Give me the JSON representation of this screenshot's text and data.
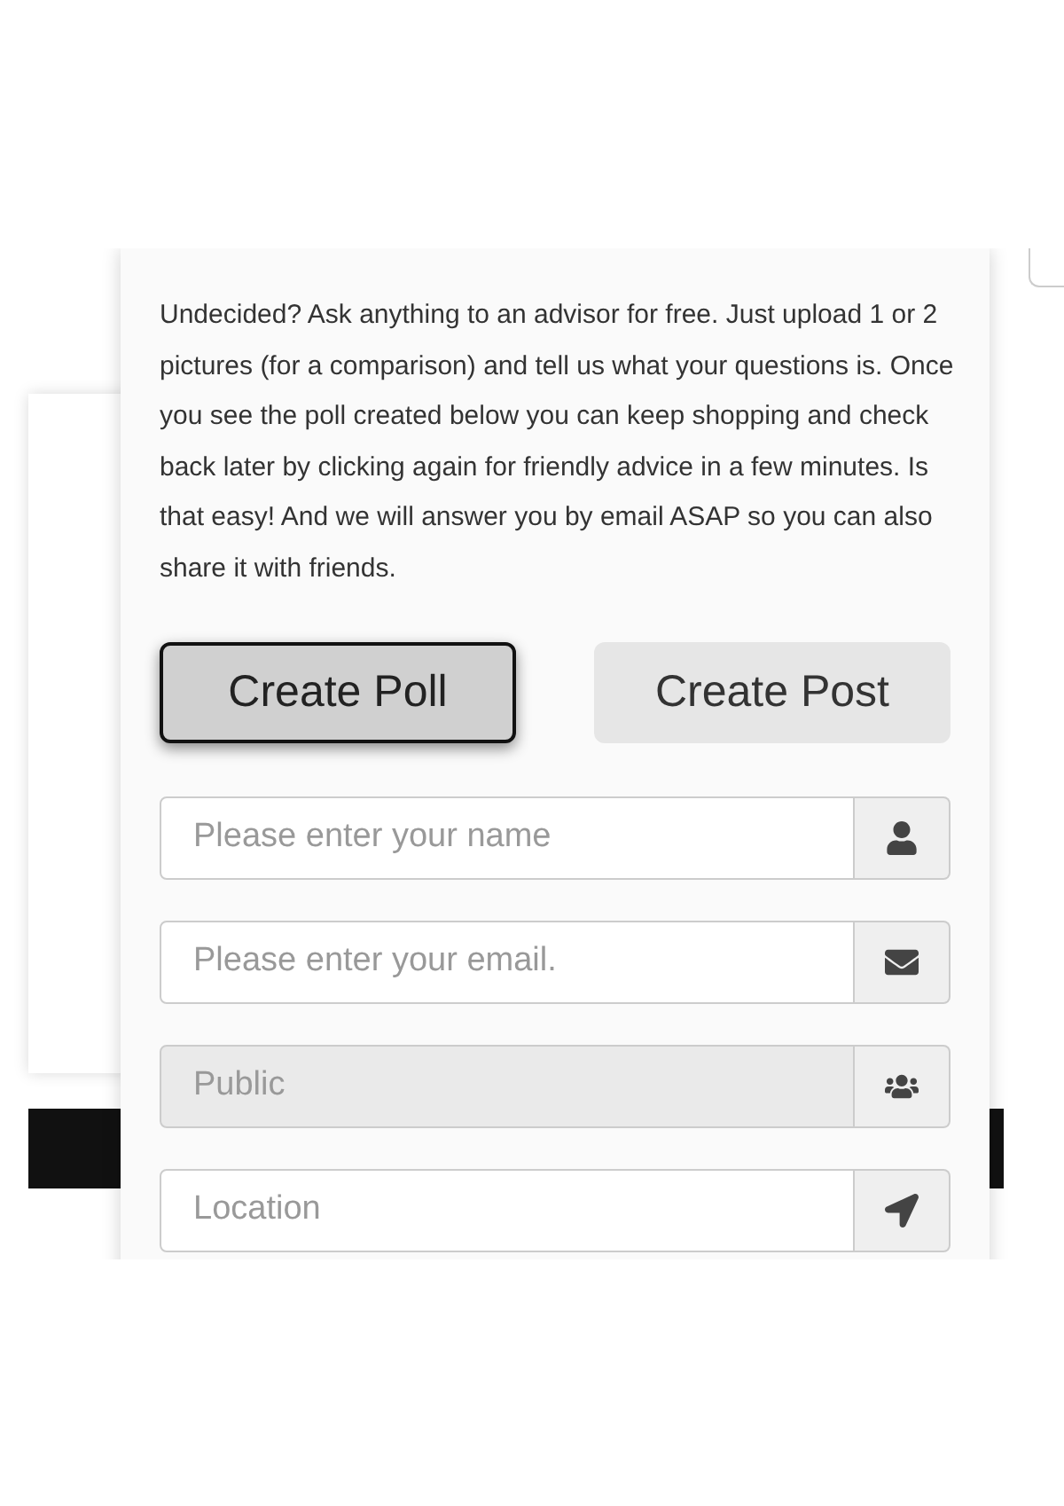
{
  "intro": "Undecided? Ask anything to an advisor for free. Just upload 1 or 2 pictures (for a comparison) and tell us what your questions is. Once you see the poll created below you can keep shopping and check back later by clicking again for friendly advice in a few minutes. Is that easy! And we will answer you by email ASAP so you can also share it with friends.",
  "tabs": [
    {
      "label": "Create Poll",
      "selected": true
    },
    {
      "label": "Create Post",
      "selected": false
    }
  ],
  "fields": [
    {
      "placeholder": "Please enter your name",
      "kind": "name",
      "disabled": false
    },
    {
      "placeholder": "Please enter your email.",
      "kind": "email",
      "disabled": false
    },
    {
      "placeholder": "Public",
      "kind": "audience",
      "disabled": true
    },
    {
      "placeholder": "Location",
      "kind": "location",
      "disabled": false
    }
  ]
}
